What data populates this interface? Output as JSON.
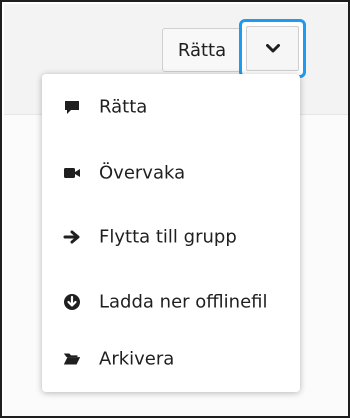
{
  "toolbar": {
    "primary_label": "Rätta",
    "toggle_icon": "chevron-down-icon"
  },
  "menu": {
    "items": [
      {
        "label": "Rätta",
        "icon": "comment-icon"
      },
      {
        "label": "Övervaka",
        "icon": "video-camera-icon"
      },
      {
        "label": "Flytta till grupp",
        "icon": "arrow-right-icon"
      },
      {
        "label": "Ladda ner offlinefil",
        "icon": "download-circle-icon"
      },
      {
        "label": "Arkivera",
        "icon": "folder-open-icon"
      }
    ]
  },
  "colors": {
    "focus_ring": "#1e9bf0",
    "text": "#1f1f1f",
    "icon": "#1f1f1f"
  }
}
